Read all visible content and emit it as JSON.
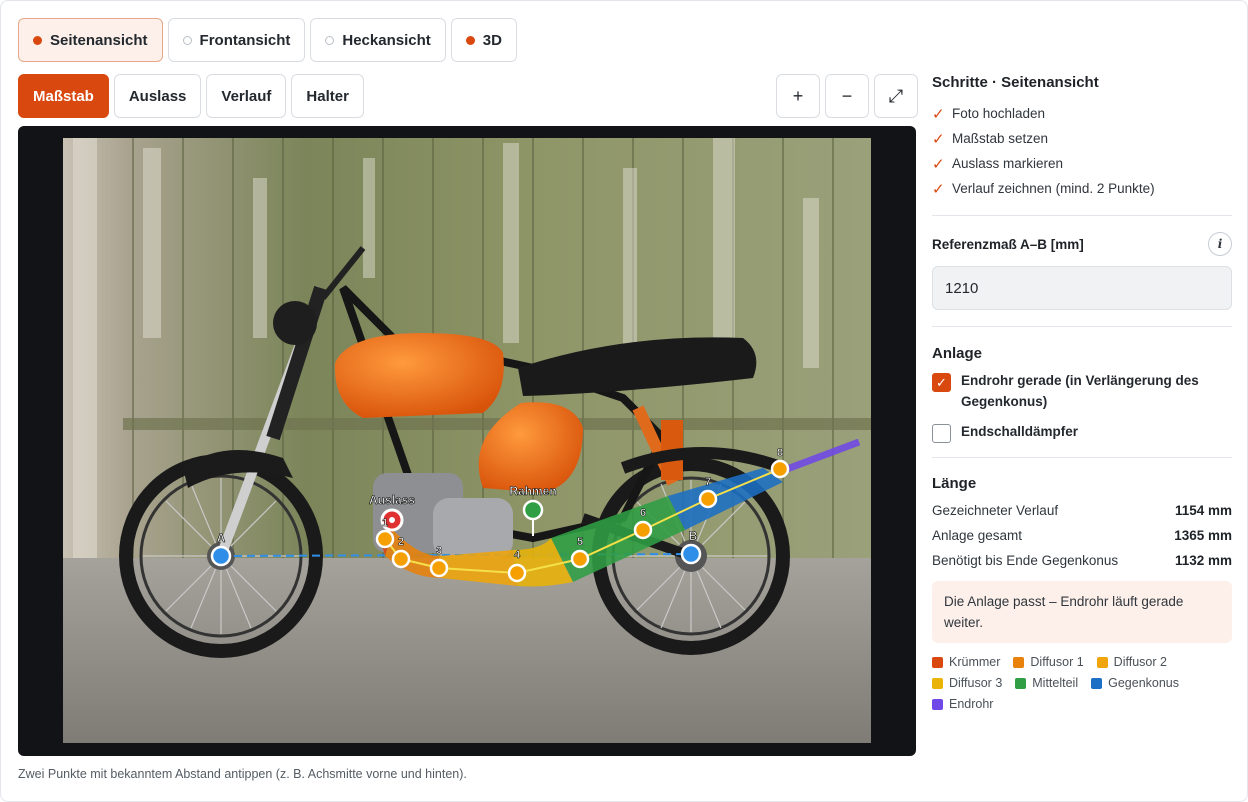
{
  "view_tabs": [
    {
      "label": "Seitenansicht",
      "active": true,
      "dot": "filled"
    },
    {
      "label": "Frontansicht",
      "active": false,
      "dot": "empty"
    },
    {
      "label": "Heckansicht",
      "active": false,
      "dot": "empty"
    },
    {
      "label": "3D",
      "active": false,
      "dot": "filled"
    }
  ],
  "tools": [
    {
      "label": "Maßstab",
      "active": true
    },
    {
      "label": "Auslass",
      "active": false
    },
    {
      "label": "Verlauf",
      "active": false
    },
    {
      "label": "Halter",
      "active": false
    }
  ],
  "zoom": {
    "in": "+",
    "out": "−",
    "fit": "⤢"
  },
  "canvas": {
    "point_a": "A",
    "point_b": "B",
    "auslass_label": "Auslass",
    "rahmen_label": "Rahmen",
    "path_points": [
      "1",
      "2",
      "3",
      "4",
      "5",
      "6",
      "7",
      "8"
    ]
  },
  "hint": "Zwei Punkte mit bekanntem Abstand antippen (z. B. Achsmitte vorne und hinten).",
  "panel": {
    "steps_title": "Schritte · Seitenansicht",
    "steps": [
      "Foto hochladen",
      "Maßstab setzen",
      "Auslass markieren",
      "Verlauf zeichnen (mind. 2 Punkte)"
    ],
    "ref_label": "Referenzmaß A–B [mm]",
    "ref_value": "1210",
    "anlage_title": "Anlage",
    "opt_endrohr": "Endrohr gerade (in Verlängerung des Gegenkonus)",
    "opt_endrohr_checked": true,
    "opt_dampfer": "Endschalldämpfer",
    "opt_dampfer_checked": false,
    "laenge_title": "Länge",
    "rows": [
      {
        "label": "Gezeichneter Verlauf",
        "value": "1154 mm"
      },
      {
        "label": "Anlage gesamt",
        "value": "1365 mm"
      },
      {
        "label": "Benötigt bis Ende Gegenkonus",
        "value": "1132 mm"
      }
    ],
    "message": "Die Anlage passt – Endrohr läuft gerade weiter.",
    "legend": [
      {
        "label": "Krümmer",
        "color": "#d9480f"
      },
      {
        "label": "Diffusor 1",
        "color": "#e8820c"
      },
      {
        "label": "Diffusor 2",
        "color": "#f0a50a"
      },
      {
        "label": "Diffusor 3",
        "color": "#eab308"
      },
      {
        "label": "Mittelteil",
        "color": "#2f9e44"
      },
      {
        "label": "Gegenkonus",
        "color": "#1c6fc4"
      },
      {
        "label": "Endrohr",
        "color": "#7048e8"
      }
    ]
  }
}
